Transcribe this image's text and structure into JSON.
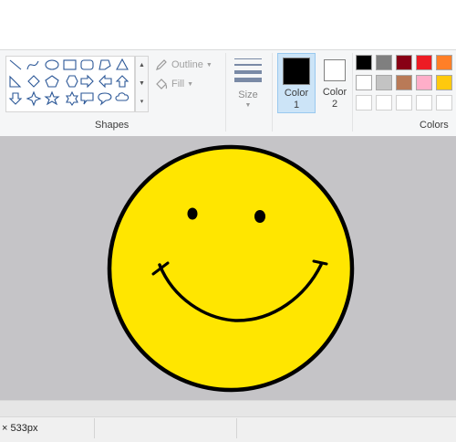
{
  "ribbon": {
    "shapes": {
      "group_label": "Shapes",
      "outline_label": "Outline",
      "fill_label": "Fill",
      "gallery_icons": [
        "line-icon",
        "curve-icon",
        "oval-icon",
        "rectangle-icon",
        "rounded-rectangle-icon",
        "polygon-icon",
        "triangle-icon",
        "right-triangle-icon",
        "diamond-icon",
        "pentagon-icon",
        "hexagon-icon",
        "right-arrow-icon",
        "left-arrow-icon",
        "up-arrow-icon",
        "down-arrow-icon",
        "four-point-star-icon",
        "five-point-star-icon",
        "six-point-star-icon",
        "rectangular-callout-icon",
        "oval-callout-icon",
        "cloud-callout-icon"
      ]
    },
    "size": {
      "label": "Size"
    },
    "colors": {
      "group_label": "Colors",
      "color1": {
        "label_line1": "Color",
        "label_line2": "1",
        "value": "#000000"
      },
      "color2": {
        "label_line1": "Color",
        "label_line2": "2",
        "value": "#ffffff"
      },
      "palette_row1": [
        "#000000",
        "#7f7f7f",
        "#880015",
        "#ed1c24",
        "#ff7f27"
      ],
      "palette_row2": [
        "#ffffff",
        "#c3c3c3",
        "#b97a57",
        "#ffaec9",
        "#ffc90e"
      ],
      "palette_row3": [
        "#ffffff",
        "#ffffff",
        "#ffffff",
        "#ffffff",
        "#ffffff"
      ]
    }
  },
  "canvas": {
    "background": "#c5c4c7",
    "drawing": {
      "face_fill": "#ffe600",
      "stroke": "#000000"
    }
  },
  "statusbar": {
    "image_size_text": "× 533px"
  }
}
